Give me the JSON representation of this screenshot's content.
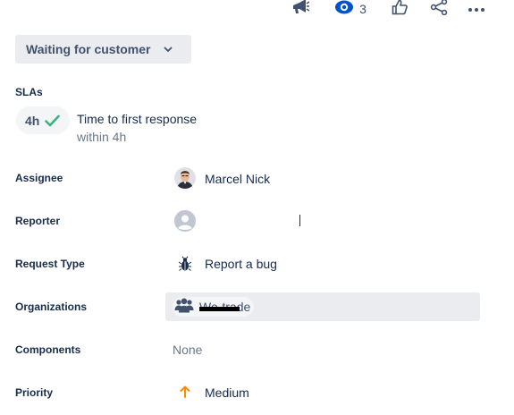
{
  "toolbar": {
    "feedback_icon": "megaphone-icon",
    "watch_icon": "eye-icon",
    "watch_count": "3",
    "like_icon": "thumbs-up-icon",
    "share_icon": "share-icon",
    "more_icon": "more-horizontal-icon"
  },
  "status": {
    "label": "Waiting for customer",
    "icon": "chevron-down-icon"
  },
  "sla": {
    "heading": "SLAs",
    "time": "4h",
    "title": "Time to first response",
    "subtitle": "within 4h",
    "check_color": "#36b37e"
  },
  "fields": {
    "assignee": {
      "label": "Assignee",
      "value": "Marcel Nick",
      "icon": "avatar-photo"
    },
    "reporter": {
      "label": "Reporter",
      "value": "",
      "icon": "avatar-placeholder-icon"
    },
    "request_type": {
      "label": "Request Type",
      "value": "Report a bug",
      "icon": "bug-icon"
    },
    "organizations": {
      "label": "Organizations",
      "value": "We-trade",
      "icon": "people-group-icon"
    },
    "components": {
      "label": "Components",
      "value": "None"
    },
    "priority": {
      "label": "Priority",
      "value": "Medium",
      "icon": "arrow-up-icon",
      "color": "#ff8b00"
    }
  }
}
